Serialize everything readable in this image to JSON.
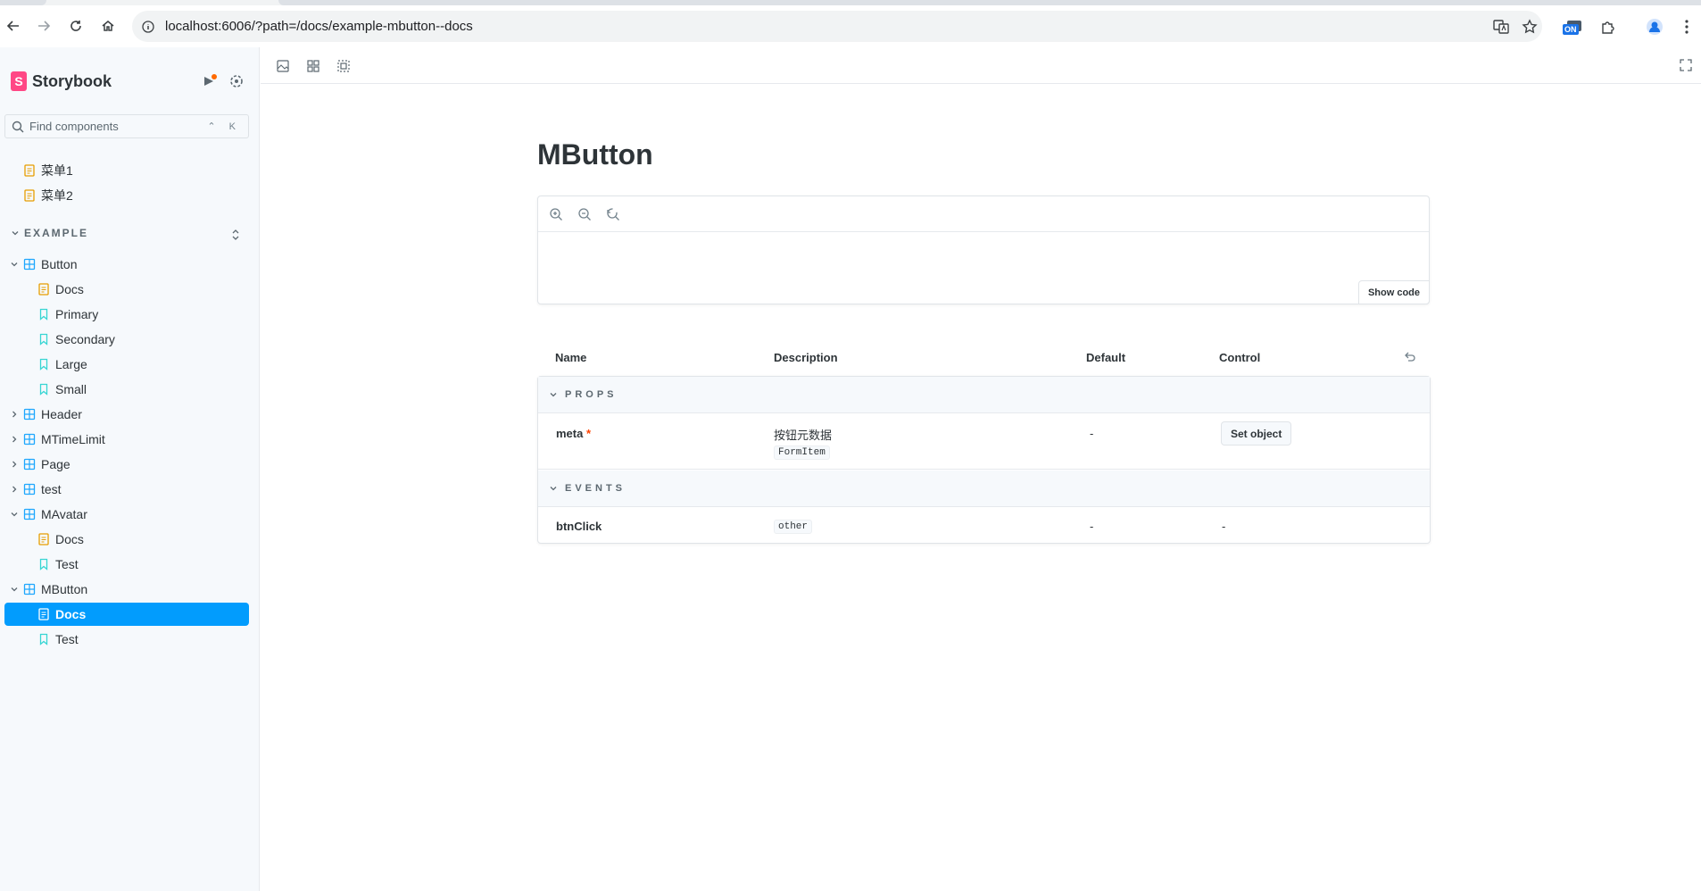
{
  "browser": {
    "url": "localhost:6006/?path=/docs/example-mbutton--docs",
    "extension_badge": "ON"
  },
  "sidebar": {
    "brand": "Storybook",
    "search_placeholder": "Find components",
    "search_shortcut": "⌃ K",
    "top_docs": [
      {
        "label": "菜单1"
      },
      {
        "label": "菜单2"
      }
    ],
    "group": "EXAMPLE",
    "tree": [
      {
        "label": "Button",
        "type": "component",
        "expanded": true
      },
      {
        "label": "Docs",
        "type": "docs"
      },
      {
        "label": "Primary",
        "type": "story"
      },
      {
        "label": "Secondary",
        "type": "story"
      },
      {
        "label": "Large",
        "type": "story"
      },
      {
        "label": "Small",
        "type": "story"
      },
      {
        "label": "Header",
        "type": "component",
        "expanded": false
      },
      {
        "label": "MTimeLimit",
        "type": "component",
        "expanded": false
      },
      {
        "label": "Page",
        "type": "component",
        "expanded": false
      },
      {
        "label": "test",
        "type": "component",
        "expanded": false
      },
      {
        "label": "MAvatar",
        "type": "component",
        "expanded": true
      },
      {
        "label": "Docs",
        "type": "docs"
      },
      {
        "label": "Test",
        "type": "story"
      },
      {
        "label": "MButton",
        "type": "component",
        "expanded": true
      },
      {
        "label": "Docs",
        "type": "docs",
        "selected": true
      },
      {
        "label": "Test",
        "type": "story"
      }
    ]
  },
  "docs": {
    "title": "MButton",
    "show_code_label": "Show code",
    "table": {
      "headers": {
        "name": "Name",
        "description": "Description",
        "default": "Default",
        "control": "Control"
      },
      "sections": {
        "props": "PROPS",
        "events": "EVENTS"
      },
      "props_rows": [
        {
          "name": "meta",
          "required_mark": "*",
          "description": "按钮元数据",
          "type": "FormItem",
          "default": "-",
          "control": "Set object"
        }
      ],
      "events_rows": [
        {
          "name": "btnClick",
          "type": "other",
          "default": "-",
          "control": "-"
        }
      ]
    }
  },
  "colors": {
    "brand": "#ff4785",
    "selected": "#029cfd",
    "docs_icon": "#e69d00",
    "story_icon": "#37d5d3",
    "component_icon": "#1ea7fd"
  }
}
